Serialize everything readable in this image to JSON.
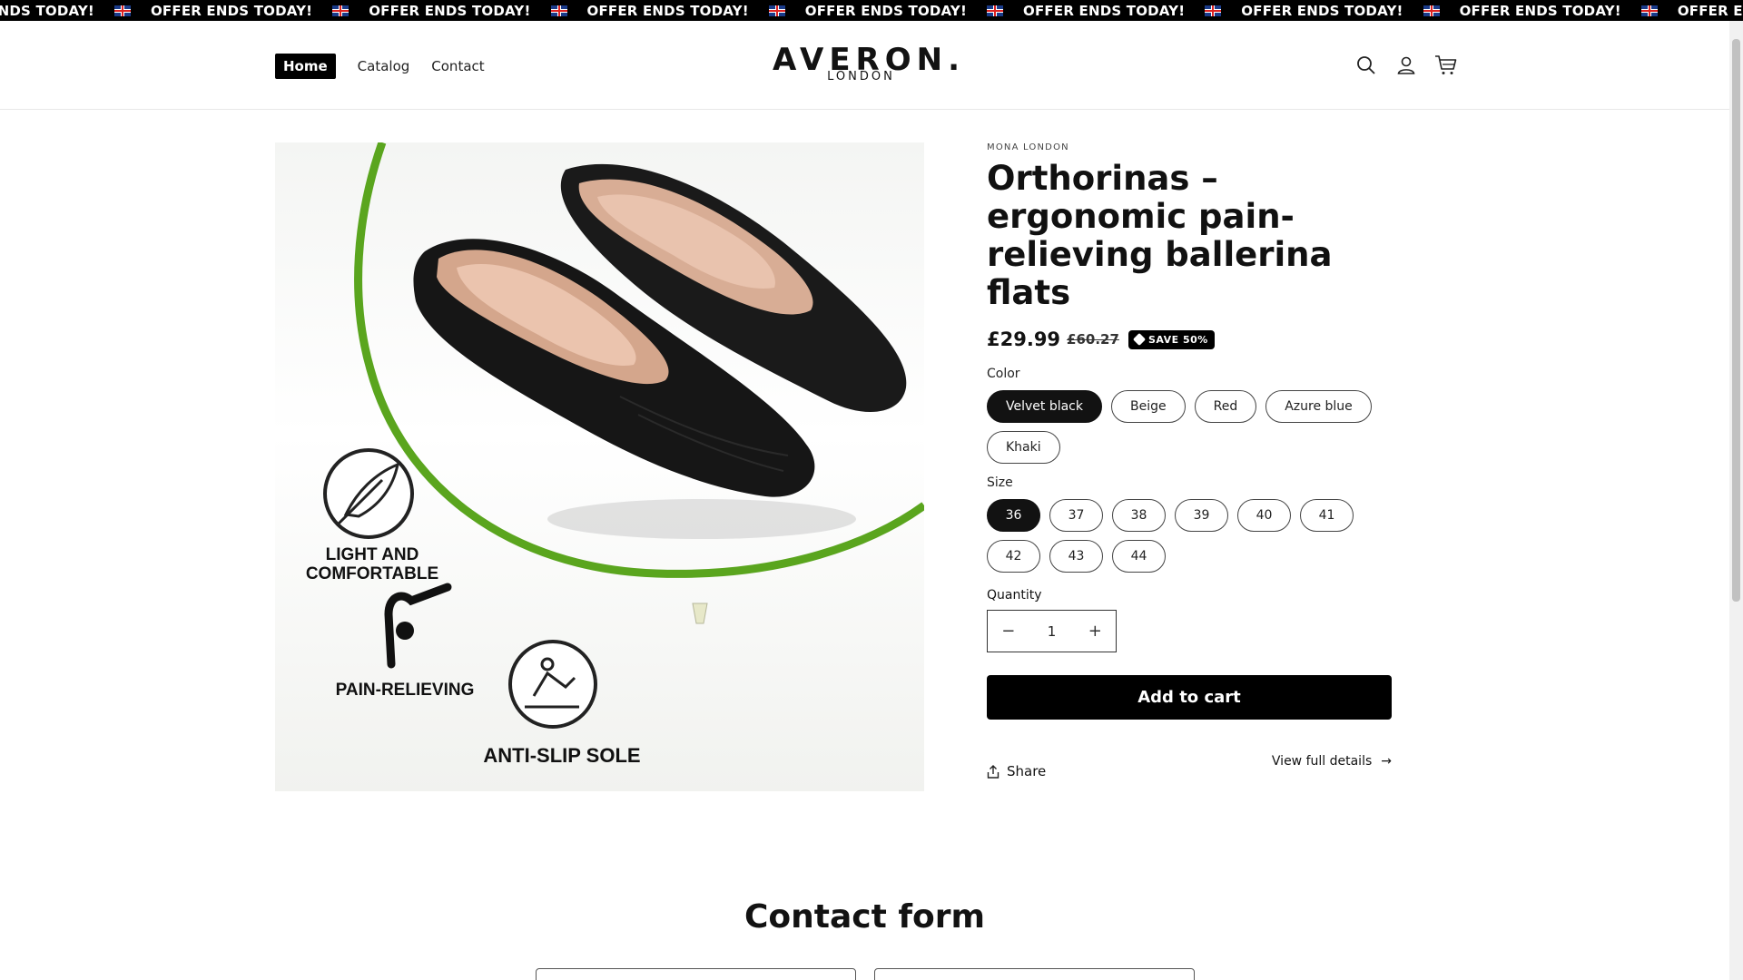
{
  "announcement": {
    "text": "OFFER ENDS TODAY!",
    "leading_text": "R ENDS TODAY!",
    "trailing_text": "OFFER"
  },
  "header": {
    "nav": [
      {
        "label": "Home"
      },
      {
        "label": "Catalog"
      },
      {
        "label": "Contact"
      }
    ],
    "logo": {
      "main": "AVERON.",
      "sub": "LONDON"
    },
    "icons": [
      "search-icon",
      "account-icon",
      "cart-icon"
    ]
  },
  "product": {
    "vendor": "MONA LONDON",
    "title": "Orthorinas – ergonomic pain-relieving ballerina flats",
    "price": "£29.99",
    "compare_price": "£60.27",
    "badge": "SAVE 50%",
    "image_labels": {
      "light": "LIGHT AND COMFORTABLE",
      "light_line1": "LIGHT AND",
      "light_line2": "COMFORTABLE",
      "pain": "PAIN-RELIEVING",
      "antislip": "ANTI-SLIP SOLE"
    },
    "color": {
      "label": "Color",
      "selected": "Velvet black",
      "options": [
        "Velvet black",
        "Beige",
        "Red",
        "Azure blue",
        "Khaki"
      ]
    },
    "size": {
      "label": "Size",
      "selected": "36",
      "options": [
        "36",
        "37",
        "38",
        "39",
        "40",
        "41",
        "42",
        "43",
        "44"
      ]
    },
    "quantity": {
      "label": "Quantity",
      "value": "1",
      "minus": "−",
      "plus": "+"
    },
    "add_to_cart": "Add to cart",
    "share": "Share",
    "view_full": "View full details",
    "view_full_arrow": "→"
  },
  "contact": {
    "title": "Contact form"
  },
  "colors": {
    "accent": "#000000",
    "green_arc": "#5aa51e"
  }
}
